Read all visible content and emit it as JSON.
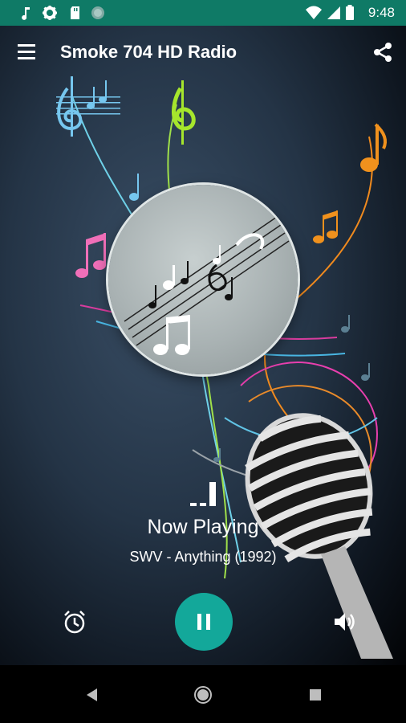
{
  "status_bar": {
    "time": "9:48",
    "left_icons": [
      "music-note-icon",
      "gear-icon",
      "sd-card-icon",
      "circle-icon"
    ],
    "right_icons": [
      "wifi-icon",
      "signal-icon",
      "battery-icon"
    ],
    "color": "#0f7a66"
  },
  "app_bar": {
    "title": "Smoke 704 HD Radio",
    "left_icon": "menu-icon",
    "right_icon": "share-icon"
  },
  "player": {
    "status_label": "Now Playing",
    "track": "SWV - Anything (1992)",
    "accent_color": "#13a89a",
    "controls": [
      "alarm-icon",
      "pause-icon",
      "volume-icon"
    ]
  },
  "nav_bar": {
    "buttons": [
      "back-icon",
      "home-icon",
      "recents-icon"
    ]
  }
}
